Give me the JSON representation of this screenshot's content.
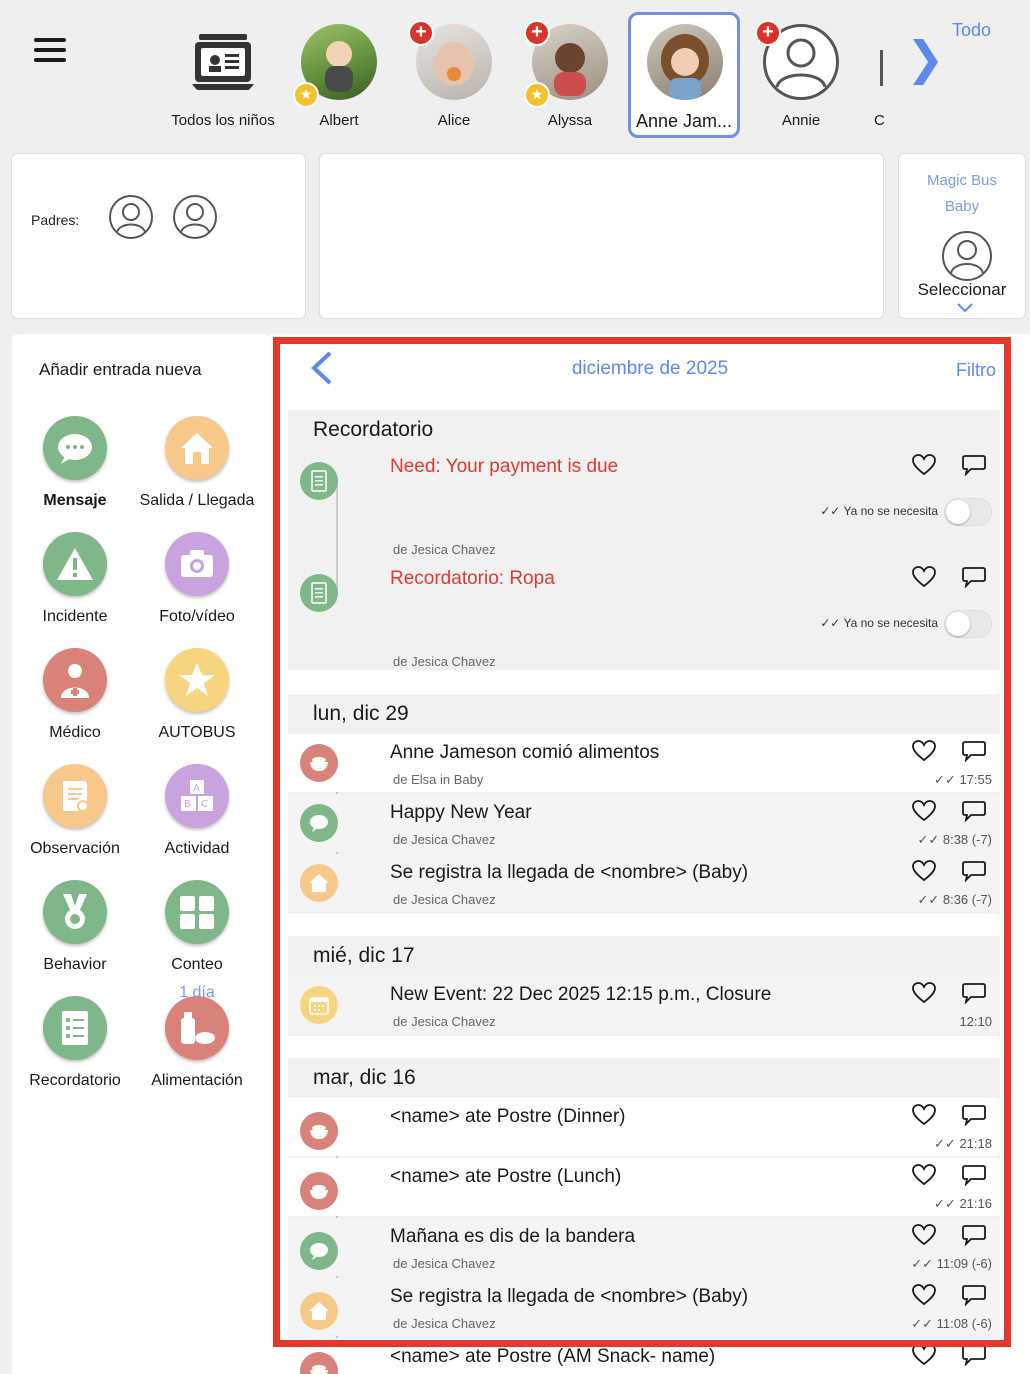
{
  "topbar": {
    "todo": "Todo",
    "children": [
      {
        "name": "Todos los niños"
      },
      {
        "name": "Albert"
      },
      {
        "name": "Alice"
      },
      {
        "name": "Alyssa"
      },
      {
        "name": "Anne Jam..."
      },
      {
        "name": "Annie"
      },
      {
        "name": "C"
      }
    ]
  },
  "parents_card": {
    "label": "Padres:"
  },
  "class_card": {
    "line1": "Magic Bus",
    "line2": "Baby",
    "select": "Seleccionar"
  },
  "left_panel": {
    "title": "Añadir entrada nueva",
    "tiles": [
      {
        "label": "Mensaje",
        "icon": "message-icon"
      },
      {
        "label": "Salida / Llegada",
        "icon": "house-icon"
      },
      {
        "label": "Incidente",
        "icon": "warning-icon"
      },
      {
        "label": "Foto/vídeo",
        "icon": "camera-icon"
      },
      {
        "label": "Médico",
        "icon": "doctor-icon"
      },
      {
        "label": "AUTOBUS",
        "icon": "star-icon"
      },
      {
        "label": "Observación",
        "icon": "clipboard-search-icon"
      },
      {
        "label": "Actividad",
        "icon": "blocks-icon"
      },
      {
        "label": "Behavior",
        "icon": "medal-icon"
      },
      {
        "label": "Conteo",
        "icon": "counter-icon"
      },
      {
        "label": "Recordatorio",
        "icon": "checklist-icon"
      },
      {
        "label": "Alimentación",
        "icon": "bottle-icon"
      }
    ],
    "feeding_badge": "1 día"
  },
  "feed": {
    "month": "diciembre de 2025",
    "filter": "Filtro",
    "not_needed": "Ya no se necesita",
    "sections": [
      {
        "header": "Recordatorio",
        "entries": [
          {
            "title": "Need: Your payment is due",
            "by": "de Jesica Chavez"
          },
          {
            "title": "Recordatorio: Ropa",
            "by": "de Jesica Chavez"
          }
        ]
      },
      {
        "header": "lun, dic 29",
        "entries": [
          {
            "title": "Anne Jameson comió alimentos",
            "by": "de Elsa in Baby",
            "time": "17:55"
          },
          {
            "title": "Happy New Year",
            "by": "de Jesica Chavez",
            "time": "8:38 (-7)"
          },
          {
            "title": "Se registra la llegada de <nombre> (Baby)",
            "by": "de Jesica Chavez",
            "time": "8:36 (-7)"
          }
        ]
      },
      {
        "header": "mié, dic 17",
        "entries": [
          {
            "title": "New Event: 22 Dec 2025 12:15 p.m., Closure",
            "by": "de Jesica Chavez",
            "time": "12:10"
          }
        ]
      },
      {
        "header": "mar, dic 16",
        "entries": [
          {
            "title": "<name> ate Postre (Dinner)",
            "by": "",
            "time": "21:18"
          },
          {
            "title": "<name> ate Postre (Lunch)",
            "by": "",
            "time": "21:16"
          },
          {
            "title": "Mañana es dis de la bandera",
            "by": "de Jesica Chavez",
            "time": "11:09 (-6)"
          },
          {
            "title": "Se registra la llegada de <nombre> (Baby)",
            "by": "de Jesica Chavez",
            "time": "11:08 (-6)"
          },
          {
            "title": "<name> ate Postre (AM Snack- name)",
            "by": "",
            "time": ""
          }
        ]
      }
    ]
  },
  "colors": {
    "accent": "#5d88ec",
    "alert_red": "#e03a30",
    "highlight": "#e4392a",
    "green": "#7fb68a",
    "orange": "#f6c98a",
    "purple": "#c8a3de",
    "salmon": "#d9827a",
    "yellow": "#f7d580"
  }
}
